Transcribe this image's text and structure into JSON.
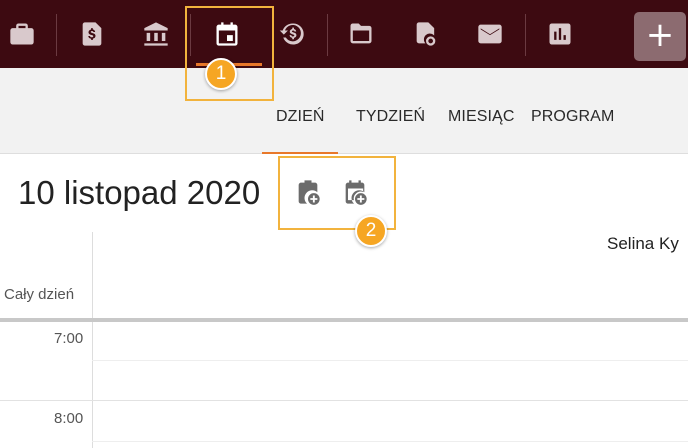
{
  "toolbar": {
    "icons": [
      "briefcase-icon",
      "dollar-document-icon",
      "bank-icon",
      "calendar-icon",
      "dollar-history-icon",
      "folder-icon",
      "certificate-icon",
      "mail-icon",
      "bar-chart-icon"
    ],
    "active_icon": "calendar-icon",
    "add_label": "+"
  },
  "view_tabs": [
    {
      "label": "DZIEŃ",
      "selected": true
    },
    {
      "label": "TYDZIEŃ",
      "selected": false
    },
    {
      "label": "MIESIĄC",
      "selected": false
    },
    {
      "label": "PROGRAM",
      "selected": false
    }
  ],
  "date_title": "10 listopad 2020",
  "date_actions": [
    "add-task-icon",
    "add-event-icon"
  ],
  "calendar": {
    "person": "Selina Ky",
    "all_day_label": "Cały dzień",
    "times": [
      "7:00",
      "8:00"
    ]
  },
  "callouts": [
    "1",
    "2"
  ],
  "colors": {
    "toolbar": "#3d0a11",
    "accent": "#e8782a",
    "callout": "#f6a623"
  }
}
